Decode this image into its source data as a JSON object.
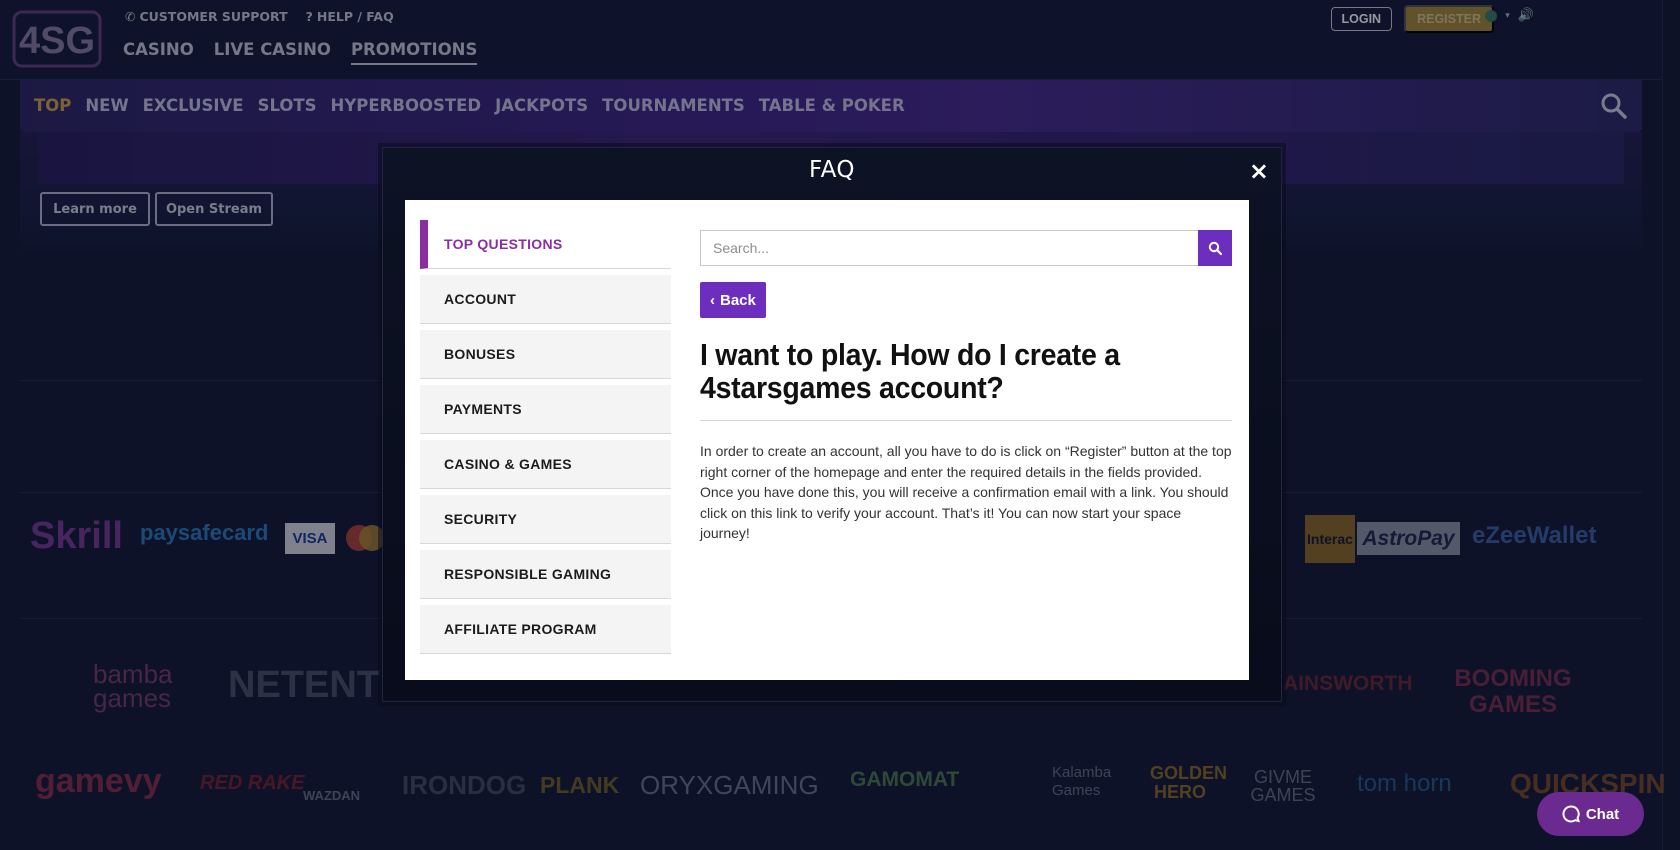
{
  "header": {
    "logo_text": "4SG",
    "customer_support": "CUSTOMER SUPPORT",
    "help_faq": "HELP / FAQ",
    "nav": [
      "CASINO",
      "LIVE CASINO",
      "PROMOTIONS"
    ],
    "login": "LOGIN",
    "register": "REGISTER"
  },
  "categories": {
    "items": [
      "TOP",
      "NEW",
      "EXCLUSIVE",
      "SLOTS",
      "HYPERBOOSTED",
      "JACKPOTS",
      "TOURNAMENTS",
      "TABLE & POKER"
    ],
    "active": "TOP"
  },
  "banner": {
    "learn_more": "Learn more",
    "open_stream": "Open Stream"
  },
  "payments": [
    "Skrill",
    "paysafecard",
    "VISA",
    "Interac",
    "AstroPay",
    "eZeeWallet"
  ],
  "providers_row1": [
    "bamba games",
    "NETENT",
    "AINSWORTH",
    "BOOMING GAMES"
  ],
  "providers_row2": [
    "gamevy",
    "RED RAKE",
    "WAZDAN",
    "IRONDOG",
    "PLANK",
    "ORYXGAMING",
    "GAMOMAT",
    "Kalamba Games",
    "GOLDEN HERO",
    "GIVME GAMES",
    "tom horn",
    "QUICKSPIN"
  ],
  "modal": {
    "title": "FAQ",
    "close": "×",
    "sidebar": [
      "TOP QUESTIONS",
      "ACCOUNT",
      "BONUSES",
      "PAYMENTS",
      "CASINO & GAMES",
      "SECURITY",
      "RESPONSIBLE GAMING",
      "AFFILIATE PROGRAM"
    ],
    "active_section": "TOP QUESTIONS",
    "search_placeholder": "Search...",
    "back": "Back",
    "question": "I want to play. How do I create a 4starsgames account?",
    "answer": "In order to create an account, all you have to do is click on “Register” button at the top right corner of the homepage and enter the required details in the fields provided. Once you have done this, you will receive a confirmation email with a link. You should click on this link to verify your account. That’s it! You can now start your space journey!"
  },
  "chat": {
    "label": "Chat"
  },
  "colors": {
    "accent_purple": "#6d2ebd",
    "active_section": "#8a2ea1",
    "page_bg": "#151b3a",
    "register_gold": "#a48a3c"
  }
}
